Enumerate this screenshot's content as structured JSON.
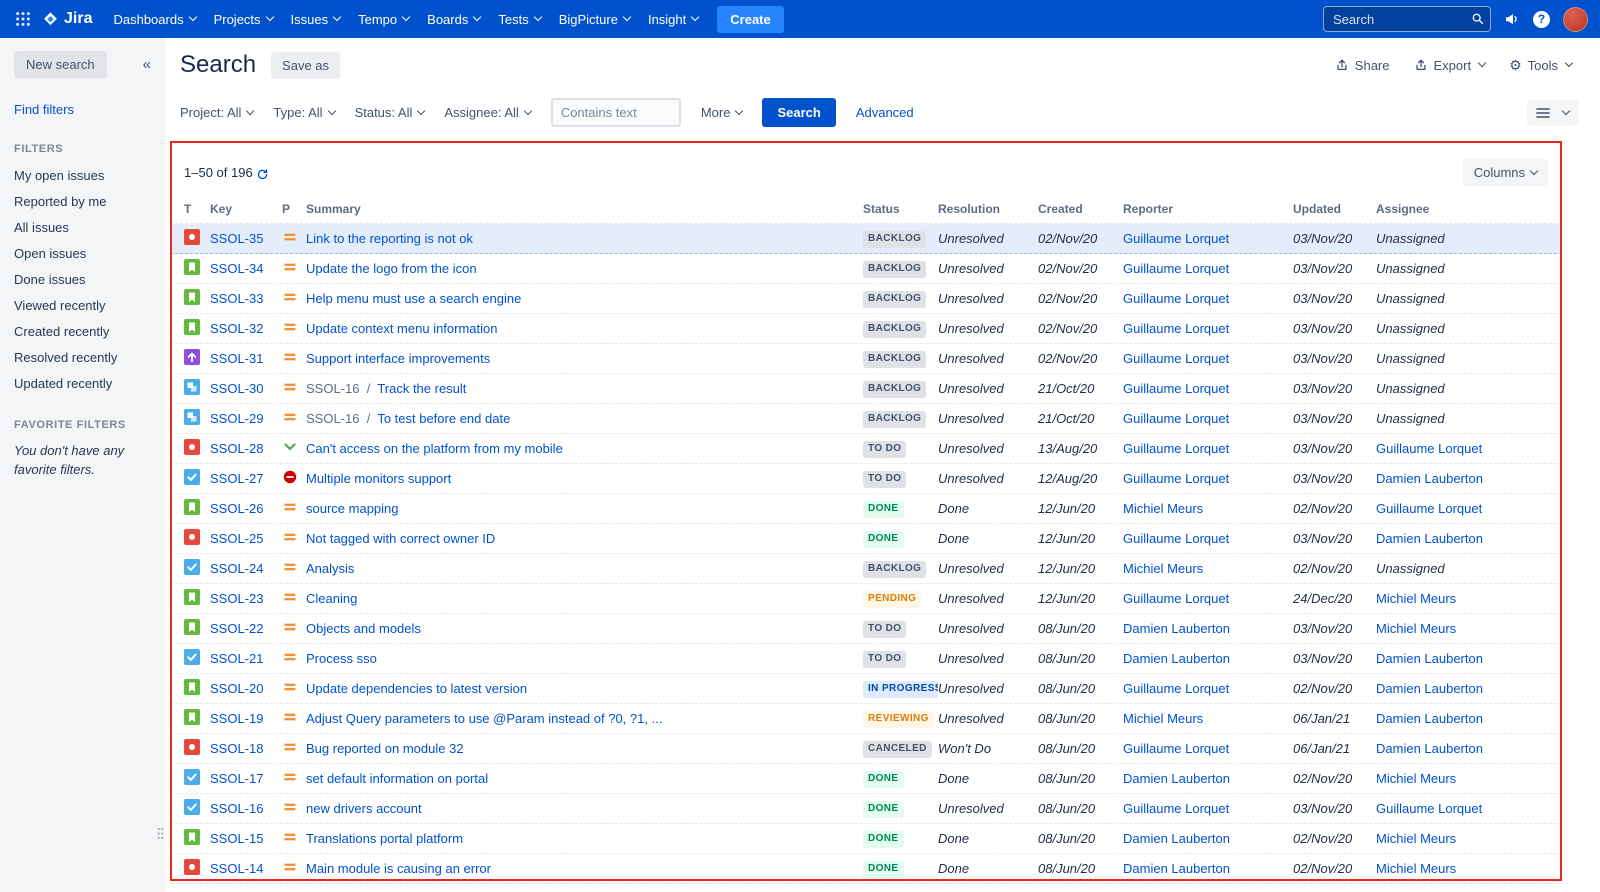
{
  "colors": {
    "navbar_bg": "#0052CC",
    "create_button_bg": "#2684FF",
    "link": "#0052CC",
    "selected_row_bg": "#E4EDFB",
    "annotation_border": "#E8291C",
    "lozenge_gray_bg": "#DFE1E6",
    "lozenge_gray_text": "#42526E",
    "lozenge_green_bg": "#E3FCEF",
    "lozenge_green_text": "#00875A",
    "lozenge_blue_bg": "#DEEBFF",
    "lozenge_blue_text": "#0747A6",
    "lozenge_orange_bg": "#FFF7E6",
    "lozenge_orange_text": "#D97D0D",
    "type_bug": "#E5493A",
    "type_story": "#63BA3C",
    "type_task": "#4BADE8",
    "type_improvement": "#904EE2",
    "type_subtask": "#4BADE8",
    "priority_medium": "#F79232",
    "priority_low": "#57A55A",
    "priority_blocker": "#CE0000"
  },
  "icons": {
    "app_switcher": "3x3-dot-grid",
    "logo_mark": "jira-diamond",
    "menu_chevron": "chevron-down",
    "global_search": "magnifier",
    "announcements": "megaphone",
    "help": "question-mark-circle",
    "user_avatar": "red-circle",
    "collapse": "«",
    "share": "arrow-up-from-tray",
    "export": "arrow-up-from-tray",
    "tools": "gear",
    "view_switcher": "hamburger-lines",
    "refresh": "circular-arrow",
    "drag_handle": "six-dots"
  },
  "navbar": {
    "app_name": "Jira",
    "menus": [
      "Dashboards",
      "Projects",
      "Issues",
      "Tempo",
      "Boards",
      "Tests",
      "BigPicture",
      "Insight"
    ],
    "create_label": "Create",
    "search_placeholder": "Search"
  },
  "sidebar": {
    "new_search_label": "New search",
    "collapse_icon": "«",
    "find_filters_label": "Find filters",
    "filters_heading": "FILTERS",
    "filters": [
      "My open issues",
      "Reported by me",
      "All issues",
      "Open issues",
      "Done issues",
      "Viewed recently",
      "Created recently",
      "Resolved recently",
      "Updated recently"
    ],
    "favorite_heading": "FAVORITE FILTERS",
    "favorite_empty": "You don't have any favorite filters."
  },
  "page_header": {
    "title": "Search",
    "save_as": "Save as",
    "share": "Share",
    "export": "Export",
    "tools": "Tools"
  },
  "filter_bar": {
    "dropdowns": [
      "Project: All",
      "Type: All",
      "Status: All",
      "Assignee: All"
    ],
    "contains_placeholder": "Contains text",
    "more_label": "More",
    "search_label": "Search",
    "advanced_label": "Advanced"
  },
  "results": {
    "count_text": "1–50 of 196",
    "columns_label": "Columns",
    "table": {
      "headers": [
        "T",
        "Key",
        "P",
        "Summary",
        "Status",
        "Resolution",
        "Created",
        "Reporter",
        "Updated",
        "Assignee"
      ],
      "rows": [
        {
          "type": "bug",
          "key": "SSOL-35",
          "priority": "medium",
          "summary": "Link to the reporting is not ok",
          "status": "BACKLOG",
          "status_kind": "gray",
          "resolution": "Unresolved",
          "created": "02/Nov/20",
          "reporter": "Guillaume Lorquet",
          "updated": "03/Nov/20",
          "assignee": "Unassigned",
          "selected": true
        },
        {
          "type": "story",
          "key": "SSOL-34",
          "priority": "medium",
          "summary": "Update the logo from the icon",
          "status": "BACKLOG",
          "status_kind": "gray",
          "resolution": "Unresolved",
          "created": "02/Nov/20",
          "reporter": "Guillaume Lorquet",
          "updated": "03/Nov/20",
          "assignee": "Unassigned"
        },
        {
          "type": "story",
          "key": "SSOL-33",
          "priority": "medium",
          "summary": "Help menu must use a search engine",
          "status": "BACKLOG",
          "status_kind": "gray",
          "resolution": "Unresolved",
          "created": "02/Nov/20",
          "reporter": "Guillaume Lorquet",
          "updated": "03/Nov/20",
          "assignee": "Unassigned"
        },
        {
          "type": "story",
          "key": "SSOL-32",
          "priority": "medium",
          "summary": "Update context menu information",
          "status": "BACKLOG",
          "status_kind": "gray",
          "resolution": "Unresolved",
          "created": "02/Nov/20",
          "reporter": "Guillaume Lorquet",
          "updated": "03/Nov/20",
          "assignee": "Unassigned"
        },
        {
          "type": "improvement",
          "key": "SSOL-31",
          "priority": "medium",
          "summary": "Support interface improvements",
          "status": "BACKLOG",
          "status_kind": "gray",
          "resolution": "Unresolved",
          "created": "02/Nov/20",
          "reporter": "Guillaume Lorquet",
          "updated": "03/Nov/20",
          "assignee": "Unassigned"
        },
        {
          "type": "subtask",
          "key": "SSOL-30",
          "priority": "medium",
          "parent": "SSOL-16",
          "summary": "Track the result",
          "status": "BACKLOG",
          "status_kind": "gray",
          "resolution": "Unresolved",
          "created": "21/Oct/20",
          "reporter": "Guillaume Lorquet",
          "updated": "03/Nov/20",
          "assignee": "Unassigned"
        },
        {
          "type": "subtask",
          "key": "SSOL-29",
          "priority": "medium",
          "parent": "SSOL-16",
          "summary": "To test before end date",
          "status": "BACKLOG",
          "status_kind": "gray",
          "resolution": "Unresolved",
          "created": "21/Oct/20",
          "reporter": "Guillaume Lorquet",
          "updated": "03/Nov/20",
          "assignee": "Unassigned"
        },
        {
          "type": "bug",
          "key": "SSOL-28",
          "priority": "low",
          "summary": "Can't access on the platform from my mobile",
          "status": "TO DO",
          "status_kind": "gray",
          "resolution": "Unresolved",
          "created": "13/Aug/20",
          "reporter": "Guillaume Lorquet",
          "updated": "03/Nov/20",
          "assignee": "Guillaume Lorquet"
        },
        {
          "type": "task",
          "key": "SSOL-27",
          "priority": "blocker",
          "summary": "Multiple monitors support",
          "status": "TO DO",
          "status_kind": "gray",
          "resolution": "Unresolved",
          "created": "12/Aug/20",
          "reporter": "Guillaume Lorquet",
          "updated": "03/Nov/20",
          "assignee": "Damien Lauberton"
        },
        {
          "type": "story",
          "key": "SSOL-26",
          "priority": "medium",
          "summary": "source mapping",
          "status": "DONE",
          "status_kind": "green",
          "resolution": "Done",
          "created": "12/Jun/20",
          "reporter": "Michiel Meurs",
          "updated": "02/Nov/20",
          "assignee": "Guillaume Lorquet"
        },
        {
          "type": "bug",
          "key": "SSOL-25",
          "priority": "medium",
          "summary": "Not tagged with correct owner ID",
          "status": "DONE",
          "status_kind": "green",
          "resolution": "Done",
          "created": "12/Jun/20",
          "reporter": "Guillaume Lorquet",
          "updated": "03/Nov/20",
          "assignee": "Damien Lauberton"
        },
        {
          "type": "task",
          "key": "SSOL-24",
          "priority": "medium",
          "summary": "Analysis",
          "status": "BACKLOG",
          "status_kind": "gray",
          "resolution": "Unresolved",
          "created": "12/Jun/20",
          "reporter": "Michiel Meurs",
          "updated": "02/Nov/20",
          "assignee": "Unassigned"
        },
        {
          "type": "story",
          "key": "SSOL-23",
          "priority": "medium",
          "summary": "Cleaning",
          "status": "PENDING",
          "status_kind": "orange",
          "resolution": "Unresolved",
          "created": "12/Jun/20",
          "reporter": "Guillaume Lorquet",
          "updated": "24/Dec/20",
          "assignee": "Michiel Meurs"
        },
        {
          "type": "story",
          "key": "SSOL-22",
          "priority": "medium",
          "summary": "Objects and models",
          "status": "TO DO",
          "status_kind": "gray",
          "resolution": "Unresolved",
          "created": "08/Jun/20",
          "reporter": "Damien Lauberton",
          "updated": "03/Nov/20",
          "assignee": "Michiel Meurs"
        },
        {
          "type": "task",
          "key": "SSOL-21",
          "priority": "medium",
          "summary": "Process sso",
          "status": "TO DO",
          "status_kind": "gray",
          "resolution": "Unresolved",
          "created": "08/Jun/20",
          "reporter": "Damien Lauberton",
          "updated": "03/Nov/20",
          "assignee": "Damien Lauberton"
        },
        {
          "type": "story",
          "key": "SSOL-20",
          "priority": "medium",
          "summary": "Update dependencies to latest version",
          "status": "IN PROGRESS",
          "status_kind": "blue",
          "resolution": "Unresolved",
          "created": "08/Jun/20",
          "reporter": "Guillaume Lorquet",
          "updated": "02/Nov/20",
          "assignee": "Damien Lauberton"
        },
        {
          "type": "story",
          "key": "SSOL-19",
          "priority": "medium",
          "summary": "Adjust Query parameters to use @Param instead of ?0, ?1, ...",
          "status": "REVIEWING",
          "status_kind": "orange",
          "resolution": "Unresolved",
          "created": "08/Jun/20",
          "reporter": "Michiel Meurs",
          "updated": "06/Jan/21",
          "assignee": "Damien Lauberton"
        },
        {
          "type": "bug",
          "key": "SSOL-18",
          "priority": "medium",
          "summary": "Bug reported on module 32",
          "status": "CANCELED",
          "status_kind": "gray",
          "resolution": "Won't Do",
          "created": "08/Jun/20",
          "reporter": "Guillaume Lorquet",
          "updated": "06/Jan/21",
          "assignee": "Damien Lauberton"
        },
        {
          "type": "task",
          "key": "SSOL-17",
          "priority": "medium",
          "summary": "set default information on portal",
          "status": "DONE",
          "status_kind": "green",
          "resolution": "Done",
          "created": "08/Jun/20",
          "reporter": "Damien Lauberton",
          "updated": "02/Nov/20",
          "assignee": "Michiel Meurs"
        },
        {
          "type": "task",
          "key": "SSOL-16",
          "priority": "medium",
          "summary": "new drivers account",
          "status": "DONE",
          "status_kind": "green",
          "resolution": "Unresolved",
          "created": "08/Jun/20",
          "reporter": "Guillaume Lorquet",
          "updated": "03/Nov/20",
          "assignee": "Guillaume Lorquet"
        },
        {
          "type": "story",
          "key": "SSOL-15",
          "priority": "medium",
          "summary": "Translations portal platform",
          "status": "DONE",
          "status_kind": "green",
          "resolution": "Done",
          "created": "08/Jun/20",
          "reporter": "Damien Lauberton",
          "updated": "02/Nov/20",
          "assignee": "Michiel Meurs"
        },
        {
          "type": "bug",
          "key": "SSOL-14",
          "priority": "medium",
          "summary": "Main module is causing an error",
          "status": "DONE",
          "status_kind": "green",
          "resolution": "Done",
          "created": "08/Jun/20",
          "reporter": "Damien Lauberton",
          "updated": "02/Nov/20",
          "assignee": "Michiel Meurs"
        }
      ]
    }
  }
}
